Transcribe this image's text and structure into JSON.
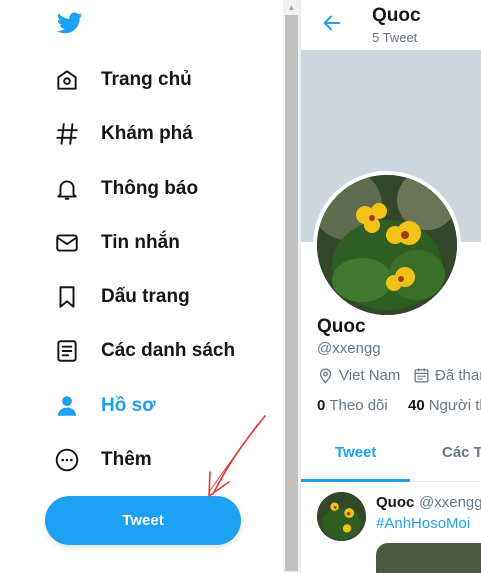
{
  "colors": {
    "accent": "#1da1f2",
    "text": "#14171a",
    "muted": "#657786",
    "banner": "#ccd6dd",
    "annotation": "#e53935"
  },
  "sidebar": {
    "logo_icon": "twitter-bird-icon",
    "items": [
      {
        "label": "Trang chủ",
        "icon": "home-icon",
        "active": false
      },
      {
        "label": "Khám phá",
        "icon": "hashtag-icon",
        "active": false
      },
      {
        "label": "Thông báo",
        "icon": "bell-icon",
        "active": false
      },
      {
        "label": "Tin nhắn",
        "icon": "mail-icon",
        "active": false
      },
      {
        "label": "Dấu trang",
        "icon": "bookmark-icon",
        "active": false
      },
      {
        "label": "Các danh sách",
        "icon": "list-icon",
        "active": false
      },
      {
        "label": "Hồ sơ",
        "icon": "person-icon",
        "active": true
      },
      {
        "label": "Thêm",
        "icon": "more-icon",
        "active": false
      }
    ],
    "tweet_button": "Tweet"
  },
  "profile": {
    "header_name": "Quoc",
    "tweet_count": "5 Tweet",
    "name": "Quoc",
    "handle": "@xxengg",
    "location": "Viet Nam",
    "joined": "Đã thar",
    "following_count": "0",
    "following_label": "Theo dõi",
    "followers_count": "40",
    "followers_label": "Người th",
    "tabs": [
      {
        "label": "Tweet",
        "active": true
      },
      {
        "label": "Các T",
        "active": false
      }
    ]
  },
  "tweet": {
    "name": "Quoc",
    "handle": "@xxengg",
    "hashtag": "#AnhHosoMoi"
  }
}
